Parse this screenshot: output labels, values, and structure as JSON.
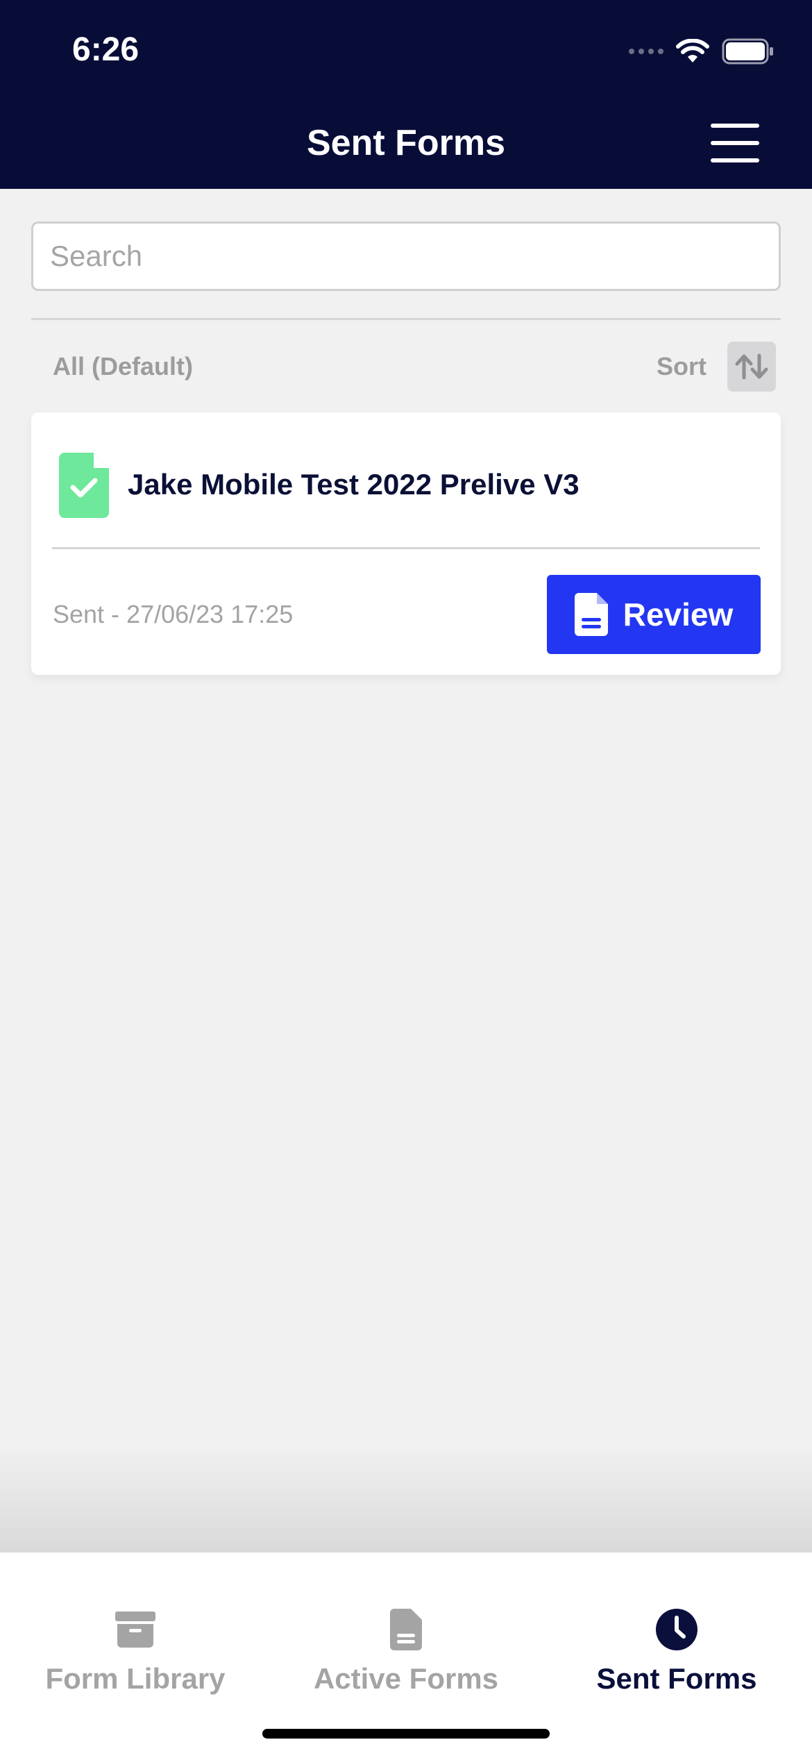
{
  "status_bar": {
    "time": "6:26"
  },
  "header": {
    "title": "Sent Forms"
  },
  "search": {
    "placeholder": "Search",
    "value": ""
  },
  "filter": {
    "label": "All (Default)",
    "sort_label": "Sort"
  },
  "forms": [
    {
      "title": "Jake Mobile Test 2022 Prelive V3",
      "sent_text": "Sent - 27/06/23 17:25",
      "button_label": "Review",
      "icon": "file-check-icon",
      "icon_color": "#6ee89a"
    }
  ],
  "tab_bar": {
    "tabs": [
      {
        "label": "Form Library",
        "icon": "archive-box-icon",
        "active": false
      },
      {
        "label": "Active Forms",
        "icon": "document-icon",
        "active": false
      },
      {
        "label": "Sent Forms",
        "icon": "clock-icon",
        "active": true
      }
    ]
  },
  "colors": {
    "header_bg": "#080d38",
    "accent": "#2337f2",
    "success": "#6ee89a",
    "background": "#f1f1f1"
  }
}
